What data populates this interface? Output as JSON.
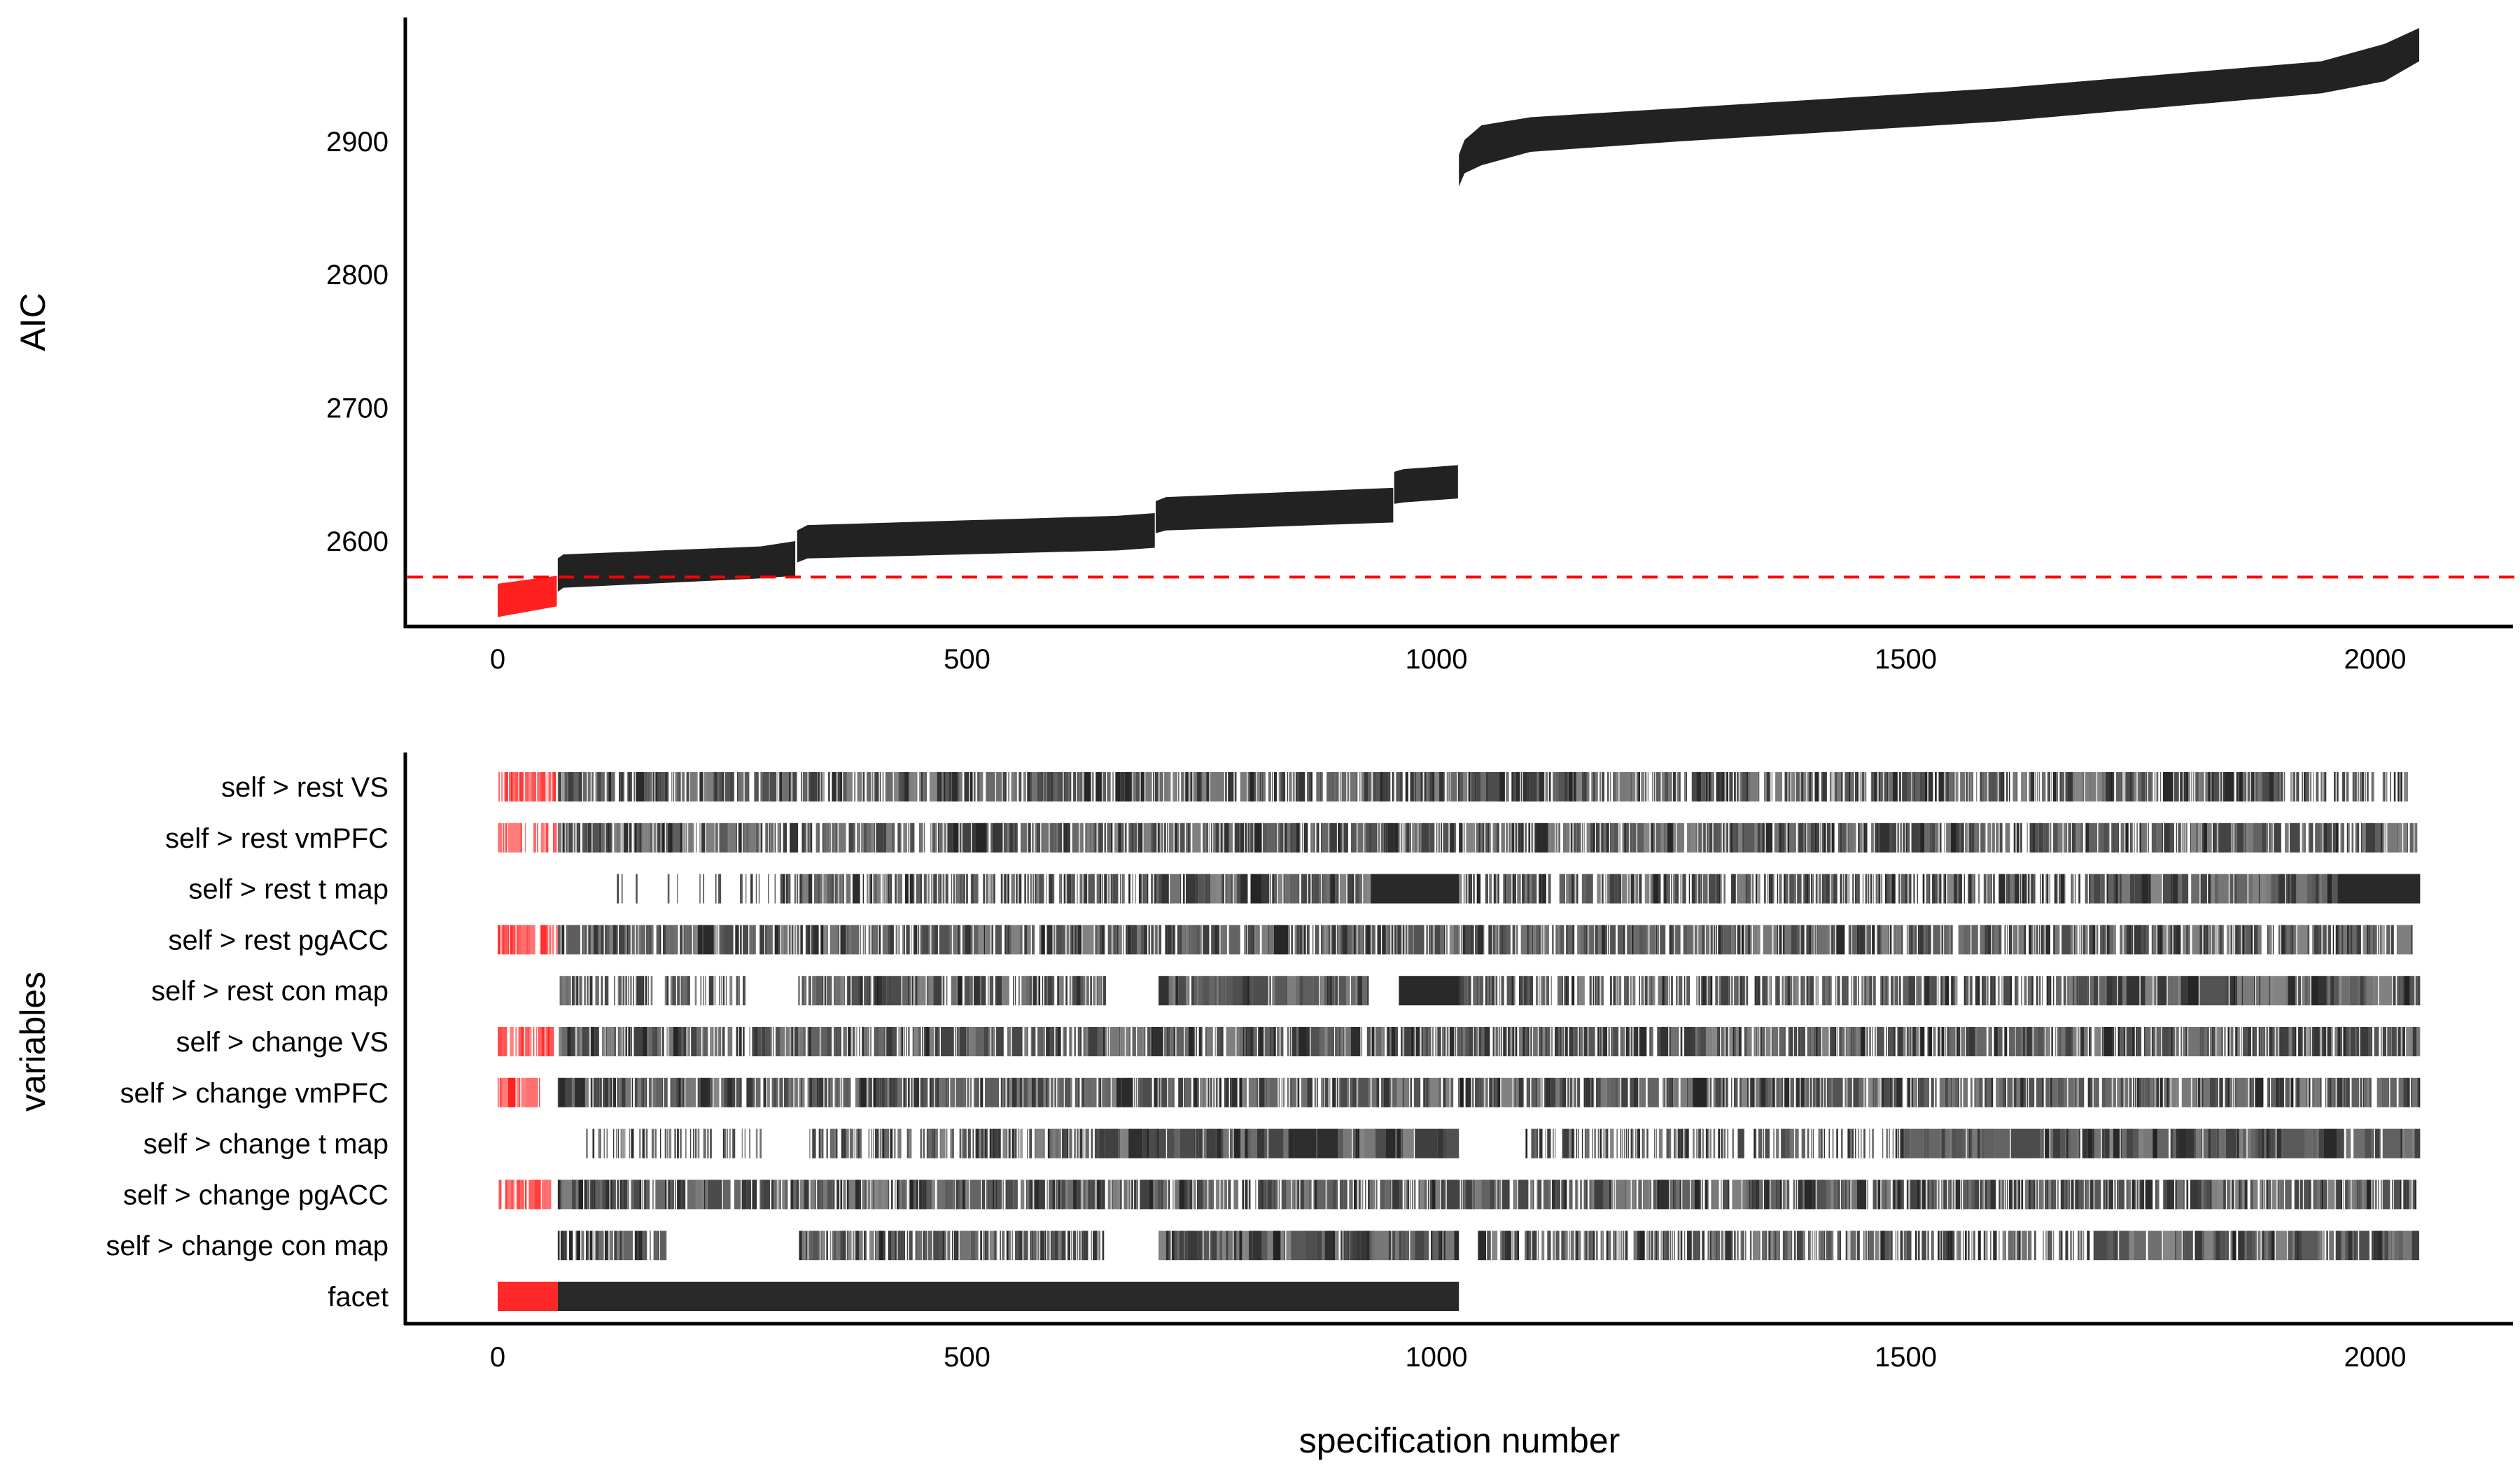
{
  "chart_data": [
    {
      "type": "area",
      "panel": "top",
      "ylabel": "AIC",
      "xlabel": "",
      "xlim": [
        -100,
        2147
      ],
      "ylim": [
        2536,
        2993
      ],
      "yticks": [
        "2600",
        "2700",
        "2800",
        "2900"
      ],
      "xticks": [
        "0",
        "500",
        "1000",
        "1500",
        "2000"
      ],
      "grid": false,
      "reference_line": {
        "value": 2573,
        "style": "dashed",
        "color": "#ff0000"
      },
      "highlight_color": "#ff2020",
      "base_color": "#222222",
      "segments": [
        {
          "highlight": true,
          "points": [
            [
              0,
              2543,
              2568
            ],
            [
              63,
              2551,
              2574
            ]
          ]
        },
        {
          "highlight": false,
          "points": [
            [
              64,
              2562,
              2587
            ],
            [
              70,
              2565,
              2590
            ],
            [
              280,
              2572,
              2596
            ],
            [
              317,
              2574,
              2600
            ]
          ]
        },
        {
          "highlight": false,
          "points": [
            [
              319,
              2584,
              2608
            ],
            [
              330,
              2587,
              2612
            ],
            [
              660,
              2593,
              2619
            ],
            [
              700,
              2595,
              2621
            ]
          ]
        },
        {
          "highlight": false,
          "points": [
            [
              701,
              2606,
              2630
            ],
            [
              712,
              2608,
              2633
            ],
            [
              954,
              2614,
              2640
            ]
          ]
        },
        {
          "highlight": false,
          "points": [
            [
              955,
              2628,
              2652
            ],
            [
              965,
              2629,
              2654
            ],
            [
              1023,
              2632,
              2657
            ]
          ]
        },
        {
          "highlight": false,
          "points": [
            [
              1024,
              2866,
              2890
            ],
            [
              1030,
              2876,
              2901
            ],
            [
              1048,
              2882,
              2912
            ],
            [
              1100,
              2892,
              2918
            ],
            [
              1261,
              2900,
              2925
            ],
            [
              1603,
              2915,
              2940
            ],
            [
              1943,
              2936,
              2960
            ],
            [
              2010,
              2945,
              2973
            ],
            [
              2047,
              2960,
              2985
            ]
          ]
        }
      ]
    },
    {
      "type": "heatmap",
      "panel": "bottom",
      "ylabel": "variables",
      "xlabel": "specification number",
      "xlim": [
        -100,
        2147
      ],
      "xticks": [
        "0",
        "500",
        "1000",
        "1500",
        "2000"
      ],
      "n_specifications": 2048,
      "highlight_until": 64,
      "highlight_color": "#ff2020",
      "base_color": "#222222",
      "variables": [
        {
          "label": "self > rest VS",
          "included_ranges": [
            [
              0,
              64,
              0.6
            ],
            [
              64,
              1900,
              0.65
            ],
            [
              1900,
              2035,
              0.4
            ]
          ]
        },
        {
          "label": "self > rest vmPFC",
          "included_ranges": [
            [
              0,
              30,
              0.8
            ],
            [
              38,
              64,
              0.5
            ],
            [
              64,
              2045,
              0.65
            ]
          ]
        },
        {
          "label": "self > rest t map",
          "included_ranges": [
            [
              120,
              300,
              0.12
            ],
            [
              300,
              700,
              0.55
            ],
            [
              700,
              930,
              0.75
            ],
            [
              930,
              1024,
              1
            ],
            [
              1024,
              1700,
              0.5
            ],
            [
              1700,
              1960,
              0.85
            ],
            [
              1960,
              2048,
              1
            ]
          ]
        },
        {
          "label": "self > rest pgACC",
          "included_ranges": [
            [
              0,
              40,
              0.7
            ],
            [
              44,
              64,
              0.5
            ],
            [
              64,
              2040,
              0.65
            ]
          ]
        },
        {
          "label": "self > rest con map",
          "included_ranges": [
            [
              64,
              264,
              0.45
            ],
            [
              320,
              648,
              0.7
            ],
            [
              704,
              928,
              0.85
            ],
            [
              960,
              1024,
              1
            ],
            [
              1024,
              1700,
              0.5
            ],
            [
              1700,
              2048,
              0.85
            ]
          ]
        },
        {
          "label": "self > change VS",
          "included_ranges": [
            [
              0,
              60,
              0.6
            ],
            [
              64,
              2048,
              0.65
            ]
          ]
        },
        {
          "label": "self > change vmPFC",
          "included_ranges": [
            [
              0,
              45,
              0.8
            ],
            [
              64,
              2048,
              0.65
            ]
          ]
        },
        {
          "label": "self > change t map",
          "included_ranges": [
            [
              90,
              284,
              0.35
            ],
            [
              328,
              640,
              0.5
            ],
            [
              640,
              1024,
              0.9
            ],
            [
              1095,
              1500,
              0.4
            ],
            [
              1500,
              2048,
              0.85
            ]
          ]
        },
        {
          "label": "self > change pgACC",
          "included_ranges": [
            [
              0,
              57,
              0.6
            ],
            [
              64,
              2044,
              0.65
            ]
          ]
        },
        {
          "label": "self > change con map",
          "included_ranges": [
            [
              64,
              180,
              0.6
            ],
            [
              320,
              646,
              0.6
            ],
            [
              704,
              1024,
              0.85
            ],
            [
              1037,
              1700,
              0.5
            ],
            [
              1700,
              2048,
              0.8
            ]
          ]
        },
        {
          "label": "facet",
          "included_ranges": [
            [
              0,
              1024,
              1
            ]
          ]
        }
      ]
    }
  ]
}
